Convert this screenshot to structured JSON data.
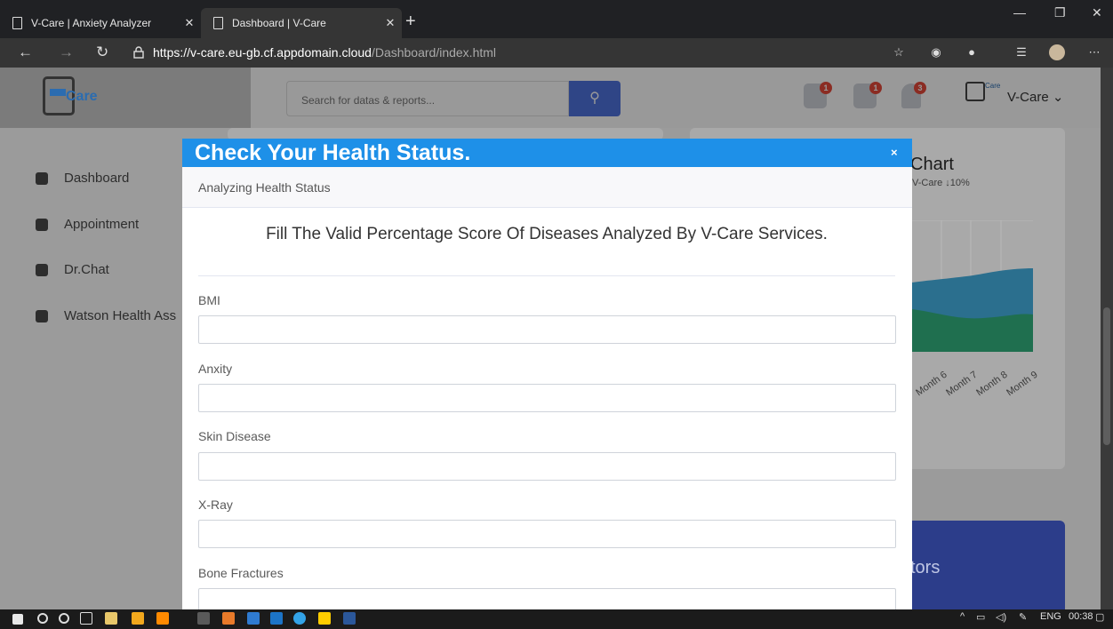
{
  "browser": {
    "tabs": [
      {
        "title": "V-Care | Anxiety Analyzer",
        "active": false
      },
      {
        "title": "Dashboard | V-Care",
        "active": true
      }
    ],
    "new_tab": "+",
    "url_scheme": "https://",
    "url_host": "v-care.eu-gb.cf.appdomain.cloud",
    "url_path": "/Dashboard/index.html"
  },
  "header": {
    "logo_text": "Care",
    "search_placeholder": "Search for datas & reports...",
    "badges": {
      "messages": "1",
      "mail": "1",
      "alerts": "3"
    },
    "user_label": "V-Care ⌄",
    "user_logo_text": "Care"
  },
  "sidebar": {
    "items": [
      {
        "label": "Dashboard",
        "icon": "tachometer-icon"
      },
      {
        "label": "Appointment",
        "icon": "calendar-icon"
      },
      {
        "label": "Dr.Chat",
        "icon": "comments-icon"
      },
      {
        "label": "Watson Health Ass",
        "icon": "user-icon"
      }
    ]
  },
  "background": {
    "chart_title": "Chart",
    "chart_sub": "V-Care ↓10%",
    "months": [
      "Month 6",
      "Month 7",
      "Month 8",
      "Month 9"
    ],
    "footer_card_text": "tors"
  },
  "modal": {
    "title": "Check Your Health Status.",
    "close": "×",
    "subtitle": "Analyzing Health Status",
    "heading": "Fill The Valid Percentage Score Of Diseases Analyzed By V-Care Services.",
    "fields": [
      {
        "label": "BMI",
        "value": ""
      },
      {
        "label": "Anxity",
        "value": ""
      },
      {
        "label": "Skin Disease",
        "value": ""
      },
      {
        "label": "X-Ray",
        "value": ""
      },
      {
        "label": "Bone Fractures",
        "value": ""
      }
    ]
  },
  "taskbar": {
    "lang": "ENG",
    "time": "00:38"
  },
  "colors": {
    "modal_header": "#1e90e8",
    "search_button": "#4e73df",
    "badge": "#e74a3b"
  }
}
